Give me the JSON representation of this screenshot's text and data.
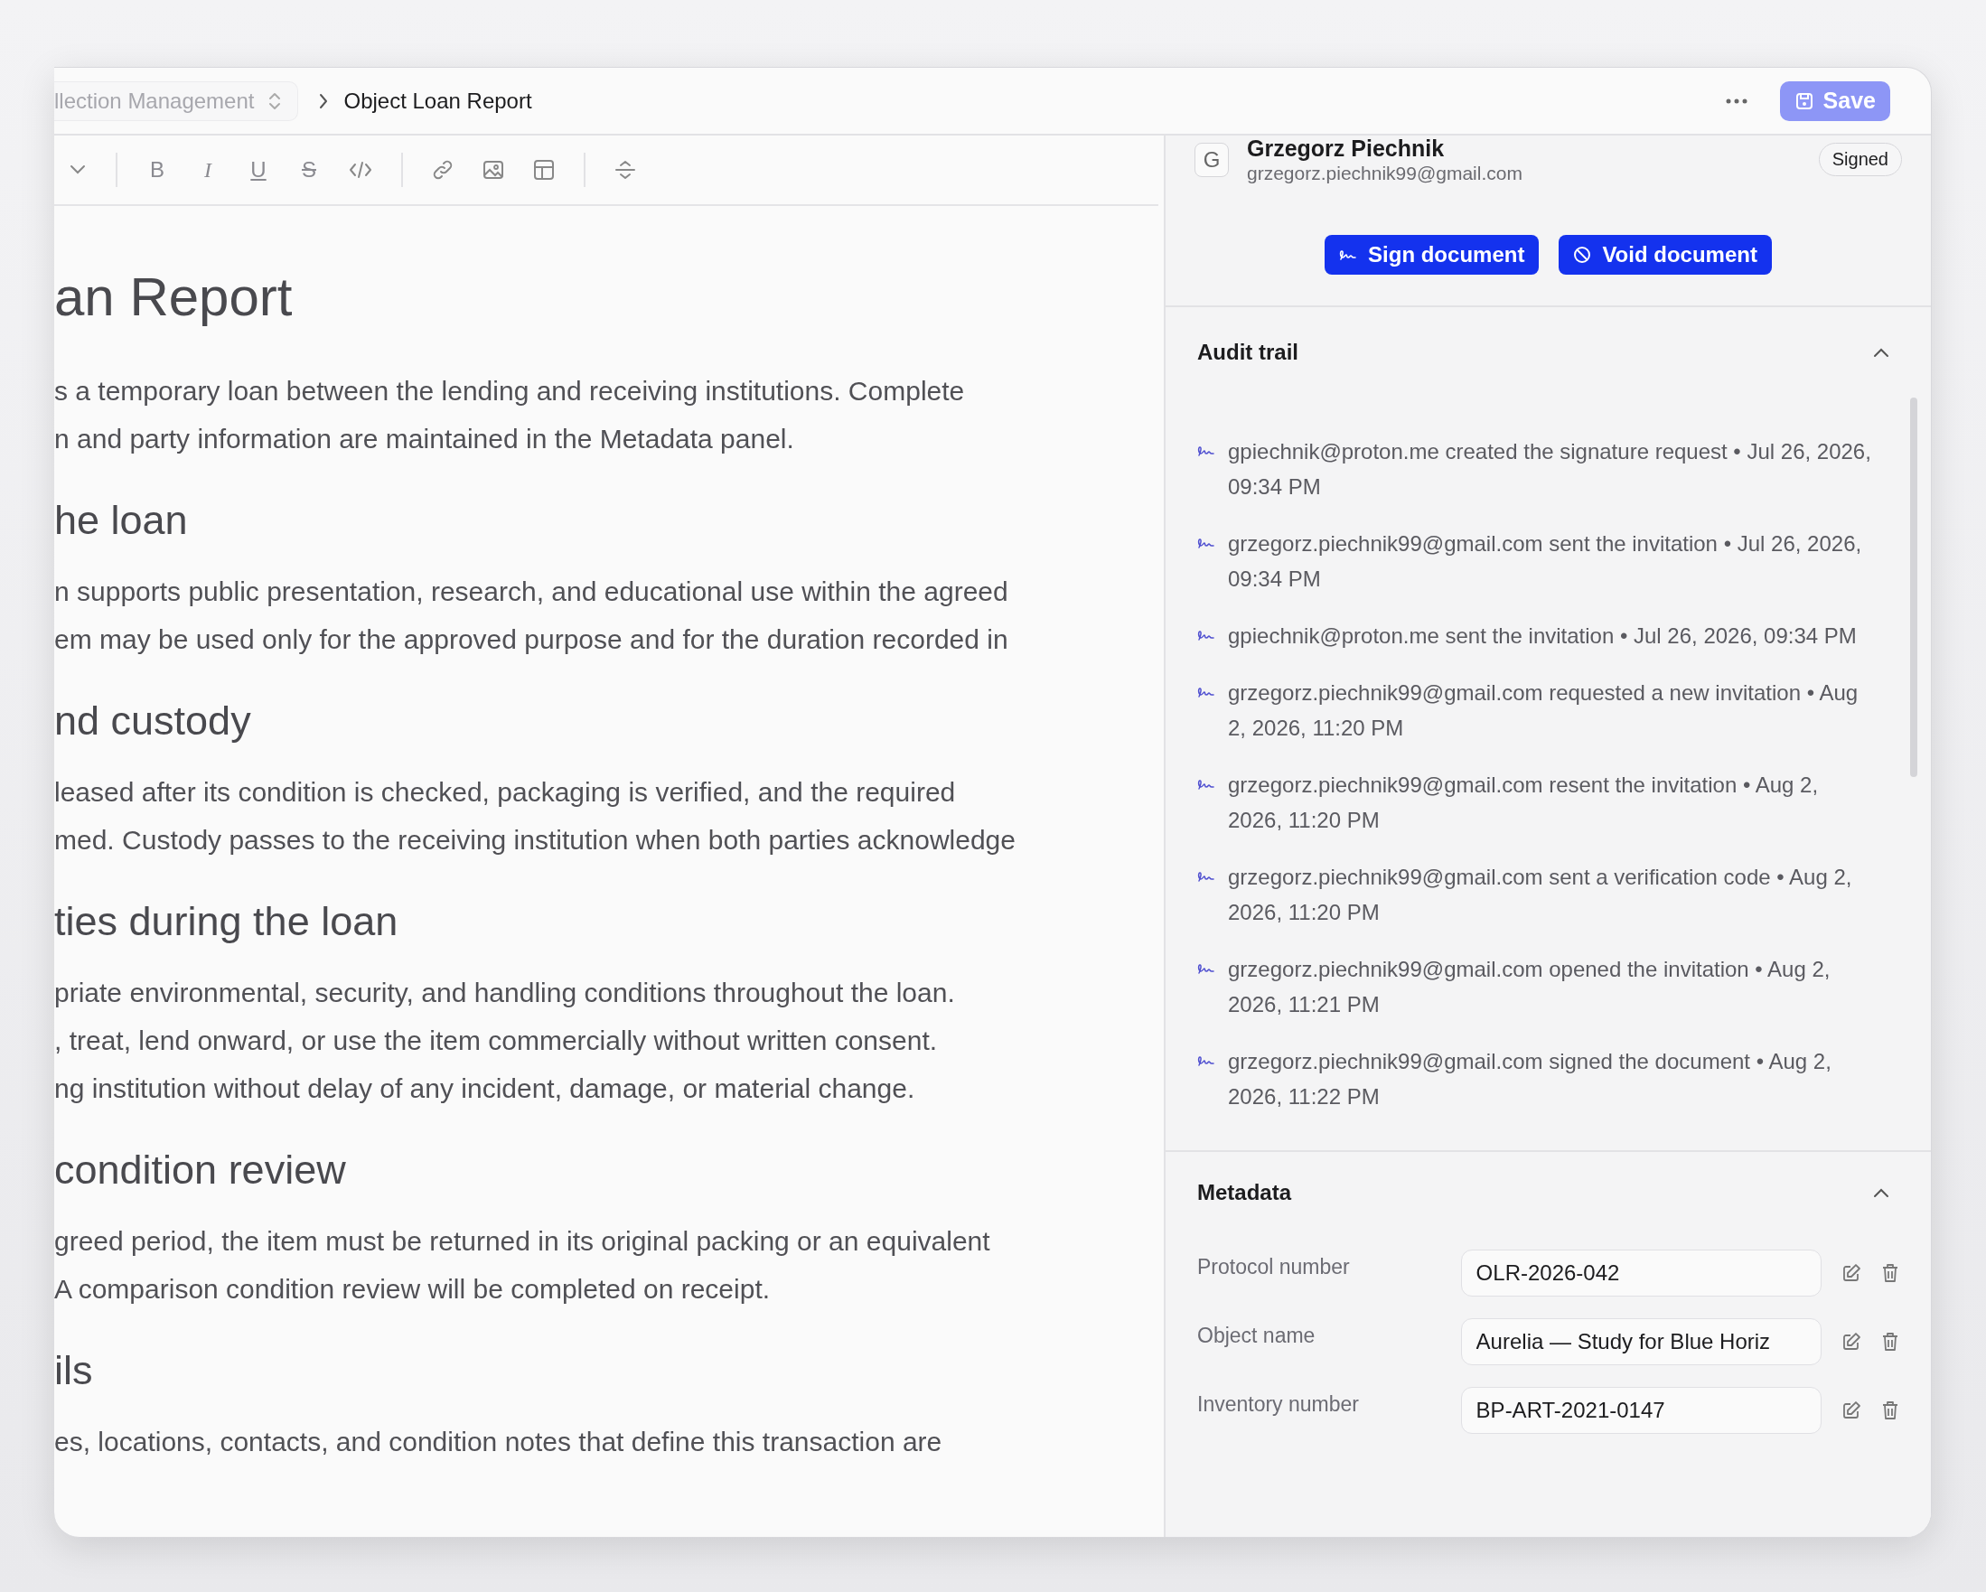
{
  "breadcrumb": {
    "parent": "llection Management",
    "current": "Object Loan Report"
  },
  "save_label": "Save",
  "format_buttons": [
    "B",
    "I",
    "U",
    "S"
  ],
  "document": {
    "title": "an Report",
    "intro": [
      "s a temporary loan between the lending and receiving institutions. Complete",
      "n and party information are maintained in the Metadata panel."
    ],
    "sections": [
      {
        "heading": "he loan",
        "lines": [
          "n supports public presentation, research, and educational use within the agreed",
          "em may be used only for the approved purpose and for the duration recorded in"
        ]
      },
      {
        "heading": "nd custody",
        "lines": [
          "leased after its condition is checked, packaging is verified, and the required",
          "med. Custody passes to the receiving institution when both parties acknowledge"
        ]
      },
      {
        "heading": "ties during the loan",
        "lines": [
          "priate environmental, security, and handling conditions throughout the loan.",
          ", treat, lend onward, or use the item commercially without written consent.",
          "ng institution without delay of any incident, damage, or material change."
        ]
      },
      {
        "heading": "condition review",
        "lines": [
          "greed period, the item must be returned in its original packing or an equivalent",
          "A comparison condition review will be completed on receipt."
        ]
      },
      {
        "heading": "ils",
        "lines": [
          "es, locations, contacts, and condition notes that define this transaction are"
        ]
      }
    ]
  },
  "signer": {
    "initial": "G",
    "name": "Grzegorz Piechnik",
    "email": "grzegorz.piechnik99@gmail.com",
    "status": "Signed"
  },
  "actions": [
    {
      "kind": "sign",
      "label": "Sign document"
    },
    {
      "kind": "void",
      "label": "Void document"
    }
  ],
  "audit_trail": {
    "title": "Audit trail",
    "expanded": true,
    "events": [
      "gpiechnik@proton.me created the signature request • Jul 26, 2026, 09:34 PM",
      "grzegorz.piechnik99@gmail.com sent the invitation • Jul 26, 2026, 09:34 PM",
      "gpiechnik@proton.me sent the invitation • Jul 26, 2026, 09:34 PM",
      "grzegorz.piechnik99@gmail.com requested a new invitation • Aug 2, 2026, 11:20 PM",
      "grzegorz.piechnik99@gmail.com resent the invitation • Aug 2, 2026, 11:20 PM",
      "grzegorz.piechnik99@gmail.com sent a verification code • Aug 2, 2026, 11:20 PM",
      "grzegorz.piechnik99@gmail.com opened the invitation • Aug 2, 2026, 11:21 PM",
      "grzegorz.piechnik99@gmail.com signed the document • Aug 2, 2026, 11:22 PM"
    ]
  },
  "metadata": {
    "title": "Metadata",
    "expanded": true,
    "fields": [
      {
        "label": "Protocol number",
        "value": "OLR-2026-042"
      },
      {
        "label": "Object name",
        "value": "Aurelia — Study for Blue Horiz"
      },
      {
        "label": "Inventory number",
        "value": "BP-ART-2021-0147"
      }
    ]
  }
}
